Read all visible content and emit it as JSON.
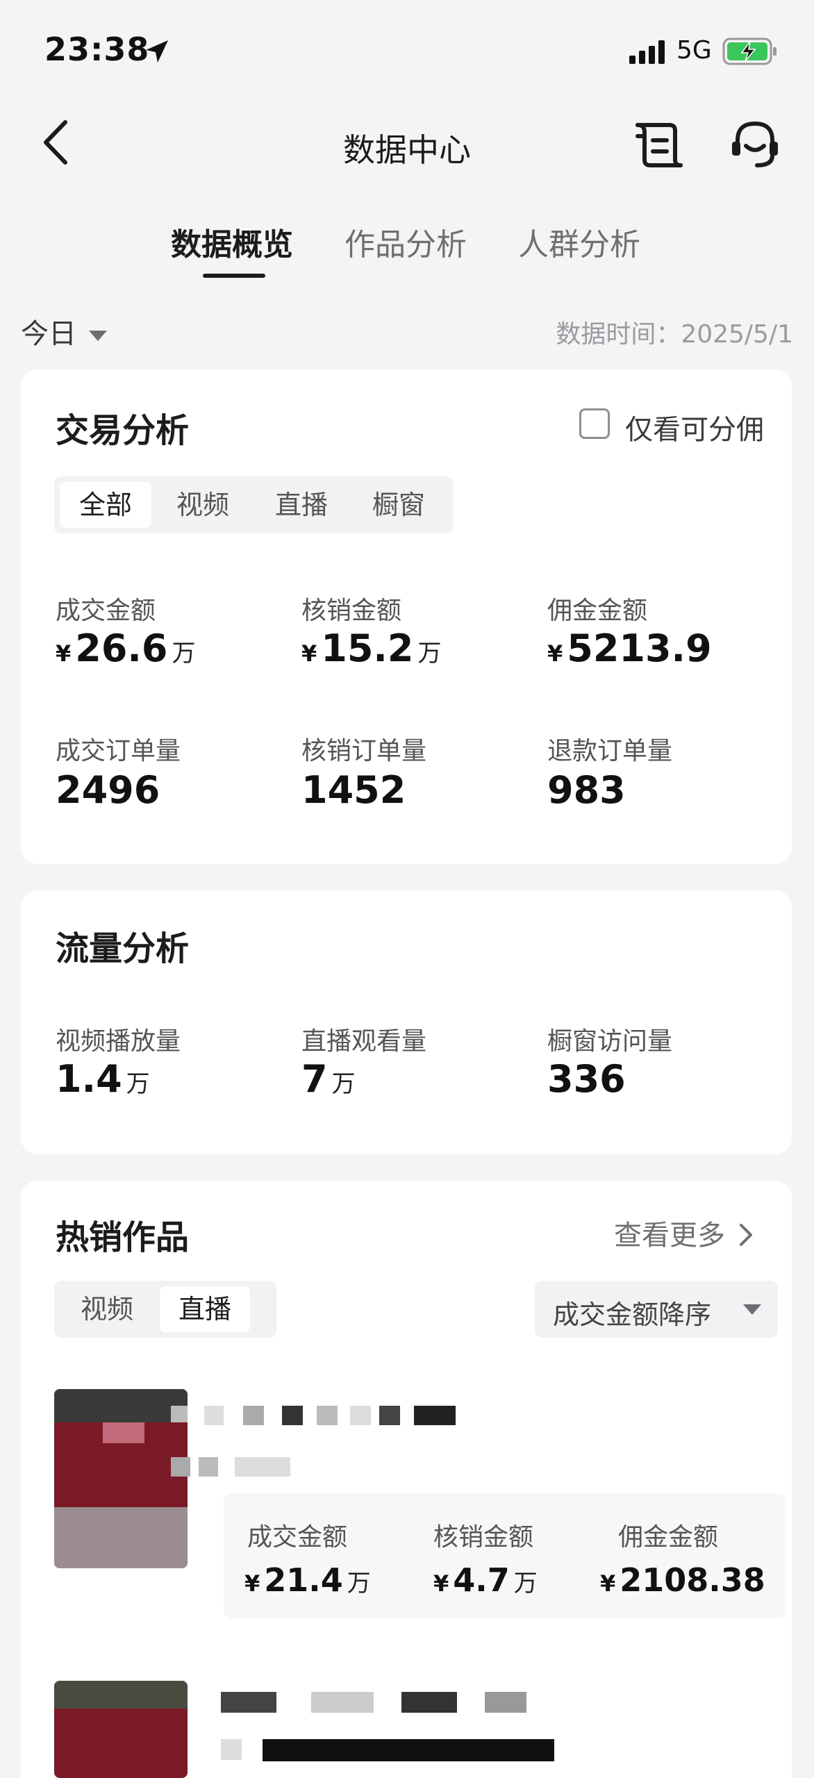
{
  "status_bar": {
    "time": "23:38",
    "network": "5G"
  },
  "nav": {
    "title": "数据中心"
  },
  "tabs": [
    {
      "label": "数据概览"
    },
    {
      "label": "作品分析"
    },
    {
      "label": "人群分析"
    }
  ],
  "filter": {
    "period": "今日",
    "data_time": "数据时间：2025/5/1"
  },
  "trade": {
    "title": "交易分析",
    "only_commission_label": "仅看可分佣",
    "segments": [
      "全部",
      "视频",
      "直播",
      "橱窗"
    ],
    "metrics": [
      {
        "label": "成交金额",
        "currency": "¥",
        "value": "26.6",
        "unit": "万"
      },
      {
        "label": "核销金额",
        "currency": "¥",
        "value": "15.2",
        "unit": "万"
      },
      {
        "label": "佣金金额",
        "currency": "¥",
        "value": "5213.9",
        "unit": ""
      },
      {
        "label": "成交订单量",
        "value": "2496"
      },
      {
        "label": "核销订单量",
        "value": "1452"
      },
      {
        "label": "退款订单量",
        "value": "983"
      }
    ]
  },
  "traffic": {
    "title": "流量分析",
    "metrics": [
      {
        "label": "视频播放量",
        "value": "1.4",
        "unit": "万"
      },
      {
        "label": "直播观看量",
        "value": "7",
        "unit": "万"
      },
      {
        "label": "橱窗访问量",
        "value": "336",
        "unit": ""
      }
    ]
  },
  "hot": {
    "title": "热销作品",
    "more_label": "查看更多",
    "segments": [
      "视频",
      "直播"
    ],
    "sort_label": "成交金额降序",
    "items": [
      {
        "stats": [
          {
            "label": "成交金额",
            "currency": "¥",
            "value": "21.4",
            "unit": "万"
          },
          {
            "label": "核销金额",
            "currency": "¥",
            "value": "4.7",
            "unit": "万"
          },
          {
            "label": "佣金金额",
            "currency": "¥",
            "value": "2108.38",
            "unit": ""
          }
        ]
      }
    ]
  }
}
